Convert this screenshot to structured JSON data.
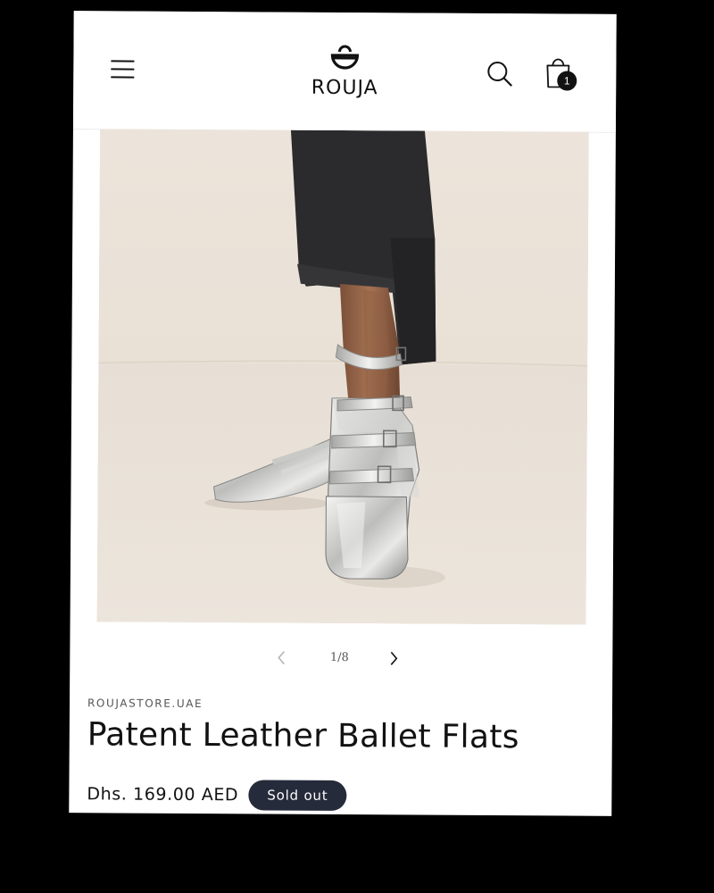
{
  "header": {
    "brand_name": "ROUJA",
    "cart_count": "1",
    "icons": {
      "menu": "menu-icon",
      "search": "search-icon",
      "cart": "shopping-bag-icon",
      "logo": "bag-logo-icon"
    }
  },
  "gallery": {
    "current": "1",
    "total": "8",
    "counter_text": "1/8",
    "image_description_icon": "product-photo"
  },
  "product": {
    "vendor": "ROUJASTORE.UAE",
    "title": "Patent Leather Ballet Flats",
    "price": "Dhs. 169.00 AED",
    "status_badge": "Sold out"
  },
  "colors": {
    "badge_bg": "#262b3b",
    "cart_badge_bg": "#121212",
    "photo_background": "#ede6dd",
    "text_primary": "#121212",
    "text_secondary": "#555555"
  }
}
